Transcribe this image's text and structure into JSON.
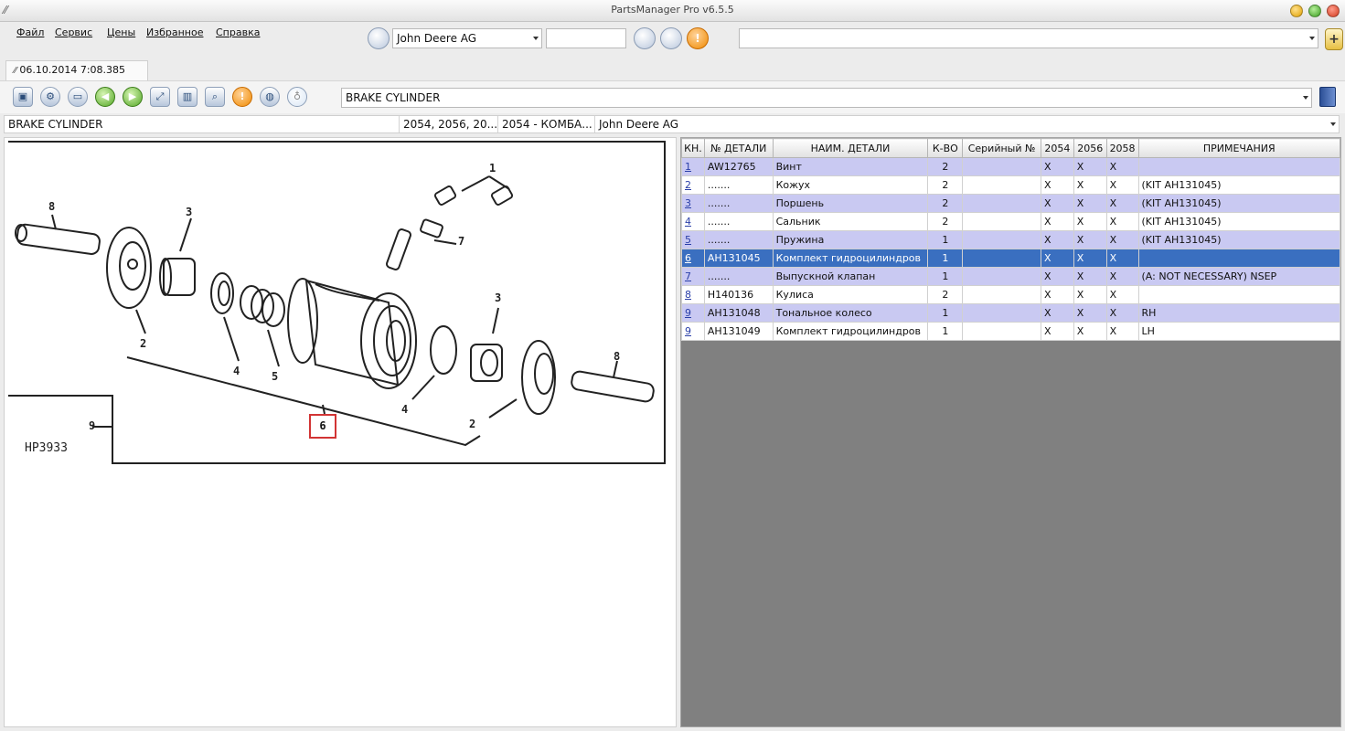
{
  "window": {
    "title": "PartsManager Pro v6.5.5"
  },
  "menu": {
    "items": [
      "Файл",
      "Сервис",
      "Цены",
      "Избранное",
      "Справка"
    ],
    "manufacturer_value": "John Deere AG",
    "search_value": "",
    "right_combo_value": ""
  },
  "tab": {
    "label": "06.10.2014 7:08.385"
  },
  "toolbar": {
    "title_value": "BRAKE CYLINDER",
    "icons": [
      "save-icon",
      "settings-icon",
      "print-icon",
      "back-arrow-icon",
      "forward-arrow-icon",
      "fullscreen-icon",
      "split-view-icon",
      "zoom-icon",
      "warning-icon",
      "globe-icon",
      "bulb-icon"
    ]
  },
  "info": {
    "title": "BRAKE CYLINDER",
    "models": "2054, 2056, 20...",
    "combine": "2054 - КОМБА...",
    "manufacturer": "John Deere AG"
  },
  "diagram": {
    "code": "HP3933",
    "selected_callout": "6",
    "callouts": [
      "1",
      "2",
      "2",
      "3",
      "3",
      "4",
      "4",
      "5",
      "7",
      "8",
      "8",
      "9"
    ]
  },
  "table": {
    "headers": [
      "КН.",
      "№ ДЕТАЛИ",
      "НАИМ. ДЕТАЛИ",
      "К-ВО",
      "Серийный №",
      "2054",
      "2056",
      "2058",
      "ПРИМЕЧАНИЯ"
    ],
    "selected_row": 5,
    "rows": [
      {
        "kn": "1",
        "part": "AW12765",
        "name": "Винт",
        "qty": "2",
        "serial": "",
        "c2054": "X",
        "c2056": "X",
        "c2058": "X",
        "note": ""
      },
      {
        "kn": "2",
        "part": ".......",
        "name": "Кожух",
        "qty": "2",
        "serial": "",
        "c2054": "X",
        "c2056": "X",
        "c2058": "X",
        "note": "(KIT AH131045)"
      },
      {
        "kn": "3",
        "part": ".......",
        "name": "Поршень",
        "qty": "2",
        "serial": "",
        "c2054": "X",
        "c2056": "X",
        "c2058": "X",
        "note": "(KIT AH131045)"
      },
      {
        "kn": "4",
        "part": ".......",
        "name": "Сальник",
        "qty": "2",
        "serial": "",
        "c2054": "X",
        "c2056": "X",
        "c2058": "X",
        "note": "(KIT AH131045)"
      },
      {
        "kn": "5",
        "part": ".......",
        "name": "Пружина",
        "qty": "1",
        "serial": "",
        "c2054": "X",
        "c2056": "X",
        "c2058": "X",
        "note": "(KIT AH131045)"
      },
      {
        "kn": "6",
        "part": "AH131045",
        "name": "Комплект гидроцилиндров",
        "qty": "1",
        "serial": "",
        "c2054": "X",
        "c2056": "X",
        "c2058": "X",
        "note": ""
      },
      {
        "kn": "7",
        "part": ".......",
        "name": "Выпускной клапан",
        "qty": "1",
        "serial": "",
        "c2054": "X",
        "c2056": "X",
        "c2058": "X",
        "note": "(A: NOT NECESSARY) NSEP"
      },
      {
        "kn": "8",
        "part": "H140136",
        "name": "Кулиса",
        "qty": "2",
        "serial": "",
        "c2054": "X",
        "c2056": "X",
        "c2058": "X",
        "note": ""
      },
      {
        "kn": "9",
        "part": "AH131048",
        "name": "Тональное колесо",
        "qty": "1",
        "serial": "",
        "c2054": "X",
        "c2056": "X",
        "c2058": "X",
        "note": "RH"
      },
      {
        "kn": "9",
        "part": "AH131049",
        "name": "Комплект гидроцилиндров",
        "qty": "1",
        "serial": "",
        "c2054": "X",
        "c2056": "X",
        "c2058": "X",
        "note": "LH"
      }
    ]
  },
  "colors": {
    "row_even": "#c9c9f2",
    "row_selected": "#3a6fc0",
    "table_background": "#808080",
    "callout_highlight": "#d23434"
  }
}
